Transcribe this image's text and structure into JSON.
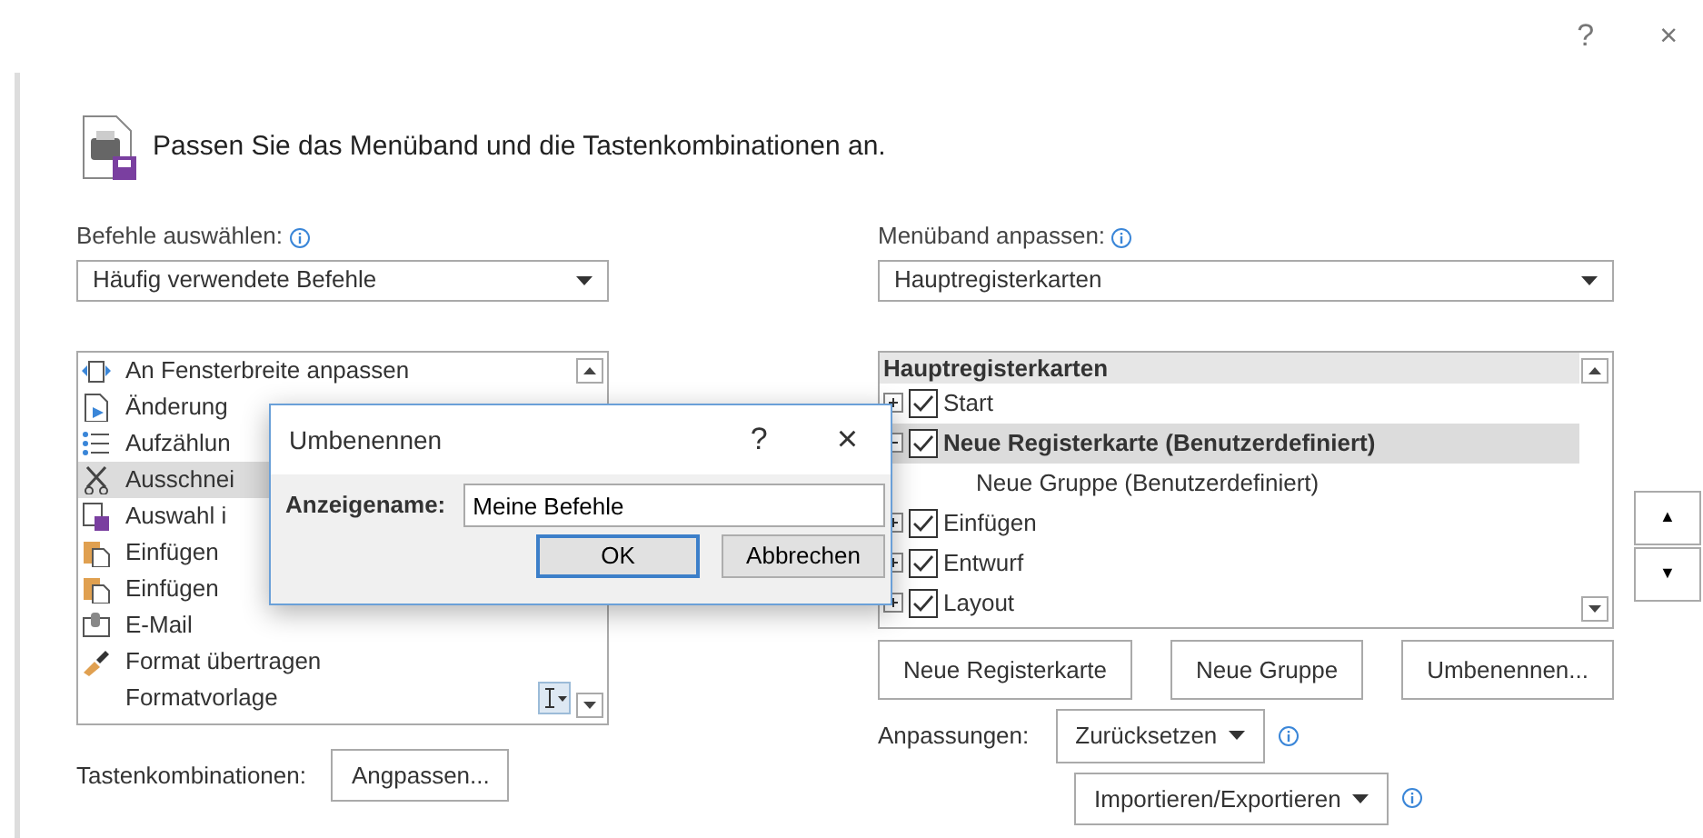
{
  "window": {
    "help": "?",
    "close": "×"
  },
  "heading": "Passen Sie das Menüband und die Tastenkombinationen an.",
  "commands": {
    "label": "Befehle auswählen:",
    "dropdown": "Häufig verwendete Befehle",
    "items": [
      {
        "label": "An Fensterbreite anpassen",
        "selected": false
      },
      {
        "label": "Änderung",
        "selected": false
      },
      {
        "label": "Aufzählun",
        "selected": false
      },
      {
        "label": "Ausschnei",
        "selected": true
      },
      {
        "label": "Auswahl i",
        "selected": false
      },
      {
        "label": "Einfügen",
        "selected": false
      },
      {
        "label": "Einfügen",
        "selected": false
      },
      {
        "label": "E-Mail",
        "selected": false
      },
      {
        "label": "Format übertragen",
        "selected": false
      },
      {
        "label": "Formatvorlage",
        "selected": false
      }
    ],
    "shortcuts_label": "Tastenkombinationen:",
    "shortcuts_button": "Angpassen..."
  },
  "ribbon": {
    "label": "Menüband anpassen:",
    "dropdown": "Hauptregisterkarten",
    "tree_header": "Hauptregisterkarten",
    "tabs": [
      {
        "label": "Start",
        "checked": true,
        "selected": false
      },
      {
        "label": "Neue Registerkarte (Benutzerdefiniert)",
        "checked": true,
        "selected": true,
        "children": [
          {
            "label": "Neue Gruppe (Benutzerdefiniert)"
          }
        ]
      },
      {
        "label": "Einfügen",
        "checked": true,
        "selected": false
      },
      {
        "label": "Entwurf",
        "checked": true,
        "selected": false
      },
      {
        "label": "Layout",
        "checked": true,
        "selected": false
      }
    ],
    "buttons": [
      "Neue Registerkarte",
      "Neue Gruppe",
      "Umbenennen..."
    ],
    "move_up": "▲",
    "move_down": "▼",
    "customizations_label": "Anpassungen:",
    "reset_button": "Zurücksetzen",
    "import_button": "Importieren/Exportieren"
  },
  "dialog": {
    "title": "Umbenennen",
    "help": "?",
    "close": "×",
    "field_label": "Anzeigename:",
    "value": "Meine Befehle",
    "ok": "OK",
    "cancel": "Abbrechen"
  }
}
